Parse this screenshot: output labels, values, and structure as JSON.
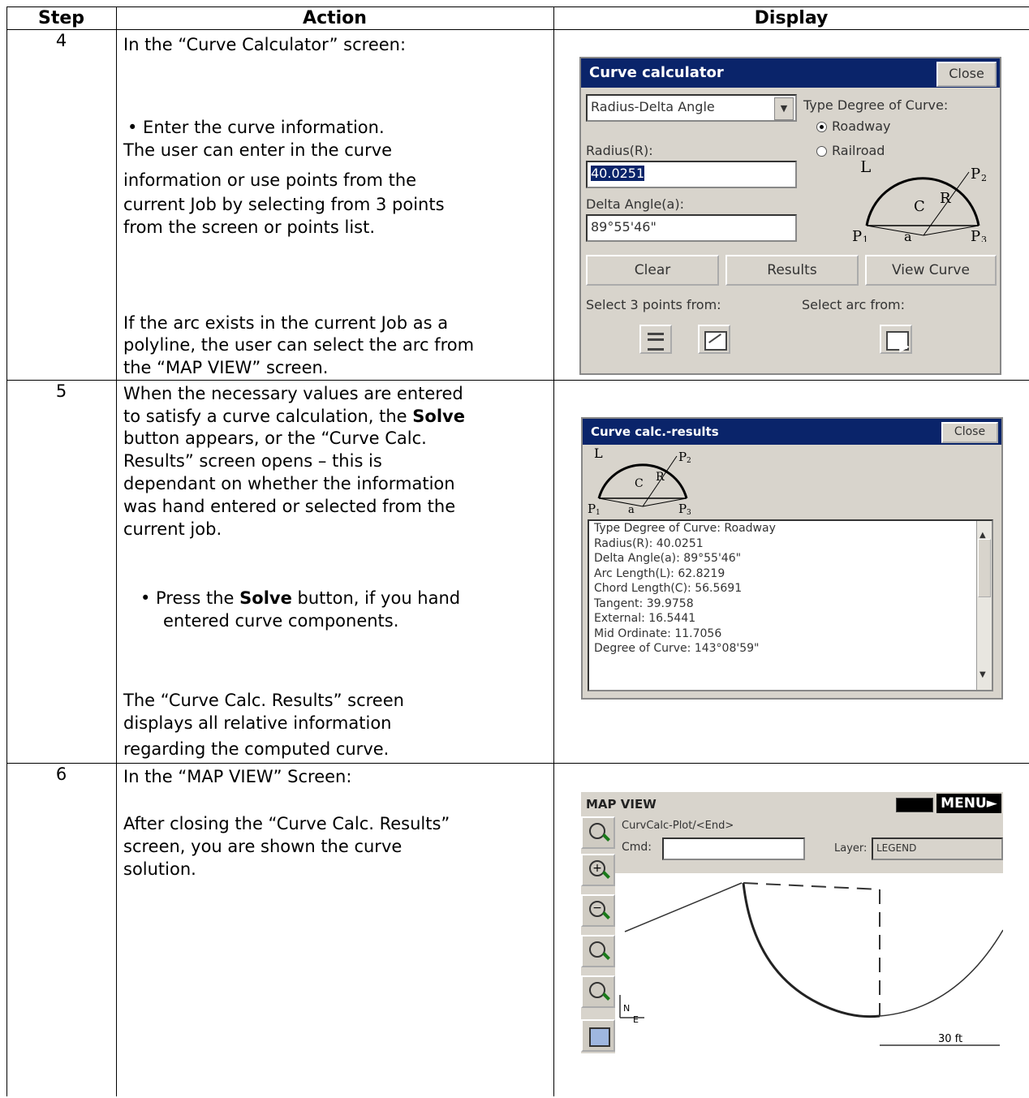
{
  "headers": {
    "step": "Step",
    "action": "Action",
    "display": "Display"
  },
  "rows": [
    {
      "step": "4",
      "lines": [
        "In the “Curve Calculator” screen:",
        "• Enter the curve information.",
        "The user can enter in the curve",
        "information or use points from the",
        "current Job by selecting from 3 points",
        "from the screen or points list.",
        "If the arc exists in the current Job as a",
        "polyline, the user can select the arc from",
        "the “MAP VIEW” screen."
      ]
    },
    {
      "step": "5",
      "lines": [
        "When the necessary values are entered",
        "to satisfy a curve calculation, the ",
        "Solve",
        "button appears, or the “Curve Calc.",
        "Results” screen opens – this is",
        "dependant on whether the information",
        "was hand entered or selected from the",
        "current job.",
        "• Press the ",
        "Solve",
        " button, if you hand",
        "entered curve components.",
        "The “Curve Calc. Results” screen",
        "displays all relative information",
        "regarding the computed curve."
      ]
    },
    {
      "step": "6",
      "lines": [
        "In the “MAP VIEW” Screen:",
        "After closing the “Curve Calc. Results”",
        "screen, you are shown the curve",
        "solution."
      ]
    }
  ],
  "calc": {
    "title": "Curve calculator",
    "close": "Close",
    "mode_select": "Radius-Delta Angle",
    "type_label": "Type Degree of Curve:",
    "opt_roadway": "Roadway",
    "opt_railroad": "Railroad",
    "radius_label": "Radius(R):",
    "radius_value": "40.0251",
    "delta_label": "Delta Angle(a):",
    "delta_value": "89°55'46\"",
    "btn_clear": "Clear",
    "btn_results": "Results",
    "btn_view": "View Curve",
    "select_points": "Select 3 points from:",
    "select_arc": "Select arc from:"
  },
  "results": {
    "title": "Curve calc.-results",
    "close": "Close",
    "lines": [
      "Type Degree of Curve: Roadway",
      "Radius(R): 40.0251",
      "Delta Angle(a): 89°55'46\"",
      "Arc Length(L): 62.8219",
      "Chord Length(C): 56.5691",
      "Tangent: 39.9758",
      "External: 16.5441",
      "Mid Ordinate: 11.7056",
      "Degree of Curve: 143°08'59\""
    ]
  },
  "diagram": {
    "L": "L",
    "C": "C",
    "R": "R",
    "a": "a",
    "P1": "P",
    "P2": "P",
    "P3": "P",
    "s1": "1",
    "s2": "2",
    "s3": "3"
  },
  "map": {
    "title": "MAP VIEW",
    "menu": "MENU",
    "path": "CurvCalc-Plot/<End>",
    "cmd_label": "Cmd:",
    "layer_label": "Layer:",
    "layer_value": "LEGEND",
    "scale": "30 ft",
    "north": "N",
    "east": "E"
  }
}
